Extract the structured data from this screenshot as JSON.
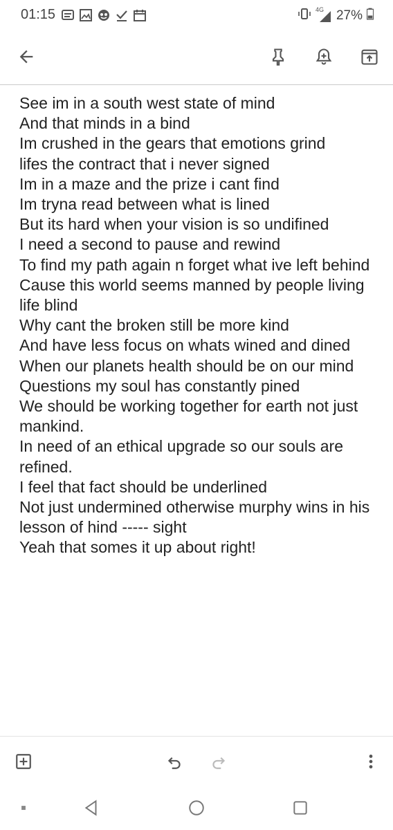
{
  "status": {
    "time": "01:15",
    "network": "4G",
    "battery": "27%",
    "left_icons": [
      "message-icon",
      "image-icon",
      "app-icon",
      "check-icon",
      "calendar-icon"
    ],
    "right_icons": [
      "vibrate-icon",
      "signal-icon",
      "battery-icon"
    ]
  },
  "toolbar": {
    "icons": [
      "back-arrow-icon",
      "pin-icon",
      "reminder-bell-icon",
      "archive-icon"
    ]
  },
  "note": {
    "lines": [
      "See im in a south west state of mind",
      "And that minds in a bind",
      "Im crushed in the gears that emotions grind",
      "lifes the contract that i never signed",
      "Im in a maze and the prize i cant find",
      "Im tryna read between what is lined",
      "But its hard when your vision is so undifined",
      "I need a second to pause and rewind",
      "To find my path again n forget what ive left behind",
      "Cause this world seems manned by people living life blind",
      "Why cant the broken still be more kind",
      "And have less focus on whats wined and dined",
      "When our planets health should be on our mind",
      "Questions my soul has constantly pined",
      "We should be working together for earth not just mankind.",
      "In need of an ethical upgrade so our souls are refined.",
      "I feel that fact should be underlined",
      "Not just undermined otherwise murphy wins in his lesson of hind ----- sight",
      "Yeah that somes it up about right!"
    ]
  },
  "bottom": {
    "icons": [
      "add-box-icon",
      "undo-icon",
      "redo-icon",
      "more-vert-icon"
    ]
  },
  "nav": {
    "icons": [
      "recents-dot-icon",
      "back-triangle-icon",
      "home-circle-icon",
      "overview-square-icon"
    ]
  }
}
